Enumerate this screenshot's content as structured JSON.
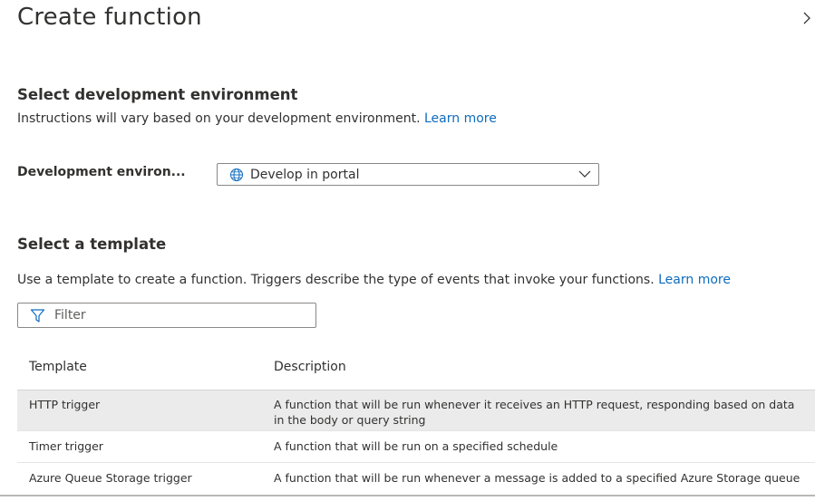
{
  "header": {
    "title": "Create function",
    "close_icon": "chevron-right-icon"
  },
  "dev_section": {
    "heading": "Select development environment",
    "description": "Instructions will vary based on your development environment.",
    "learn_more": "Learn more",
    "field_label": "Development environ...",
    "dropdown": {
      "icon": "globe-icon",
      "selected": "Develop in portal"
    }
  },
  "template_section": {
    "heading": "Select a template",
    "description": "Use a template to create a function. Triggers describe the type of events that invoke your functions.",
    "learn_more": "Learn more",
    "filter": {
      "icon": "filter-icon",
      "placeholder": "Filter"
    },
    "table": {
      "columns": [
        "Template",
        "Description"
      ],
      "rows": [
        {
          "template": "HTTP trigger",
          "description": "A function that will be run whenever it receives an HTTP request, responding based on data in the body or query string",
          "selected": true
        },
        {
          "template": "Timer trigger",
          "description": "A function that will be run on a specified schedule",
          "selected": false
        },
        {
          "template": "Azure Queue Storage trigger",
          "description": "A function that will be run whenever a message is added to a specified Azure Storage queue",
          "selected": false
        }
      ]
    }
  },
  "colors": {
    "link": "#0f6cbd",
    "text": "#323130",
    "selected_row": "#ebebeb"
  }
}
